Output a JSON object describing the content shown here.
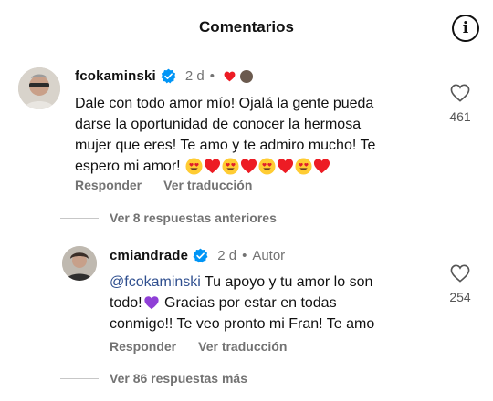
{
  "header": {
    "title": "Comentarios",
    "info_icon": "info-icon"
  },
  "comment": {
    "username": "fcokaminski",
    "verified": true,
    "time": "2 d",
    "separator": "•",
    "text_lines": [
      "Dale con todo amor mío! Ojalá la gente pueda",
      "darse la oportunidad de conocer la hermosa",
      "mujer que eres! Te amo y te admiro mucho! Te",
      "espero mi amor!"
    ],
    "emojis": [
      "heart-eyes",
      "red-heart",
      "heart-eyes",
      "red-heart",
      "heart-eyes",
      "red-heart",
      "heart-eyes",
      "red-heart"
    ],
    "reply_label": "Responder",
    "translate_label": "Ver traducción",
    "likes": "461",
    "liked_by_author_icon": "red-heart-icon"
  },
  "more_replies": {
    "label": "Ver 8 respuestas anteriores"
  },
  "reply": {
    "username": "cmiandrade",
    "verified": true,
    "time": "2 d",
    "separator": "•",
    "author_badge": "Autor",
    "mention": "@fcokaminski",
    "line1_rest": " Tu apoyo y tu amor lo son",
    "line2_a": "todo!",
    "line2_b": " Gracias por estar en todas",
    "line3": "conmigo!! Te veo pronto mi Fran! Te amo",
    "reply_label": "Responder",
    "translate_label": "Ver traducción",
    "likes": "254"
  },
  "more_replies_2": {
    "label": "Ver 86 respuestas más"
  },
  "colors": {
    "text": "#111111",
    "muted": "#737373",
    "verified_blue": "#0095f6",
    "heart_red": "#ed1c24",
    "mention_blue": "#2f4f8f",
    "purple_heart": "#8f3fd6"
  }
}
